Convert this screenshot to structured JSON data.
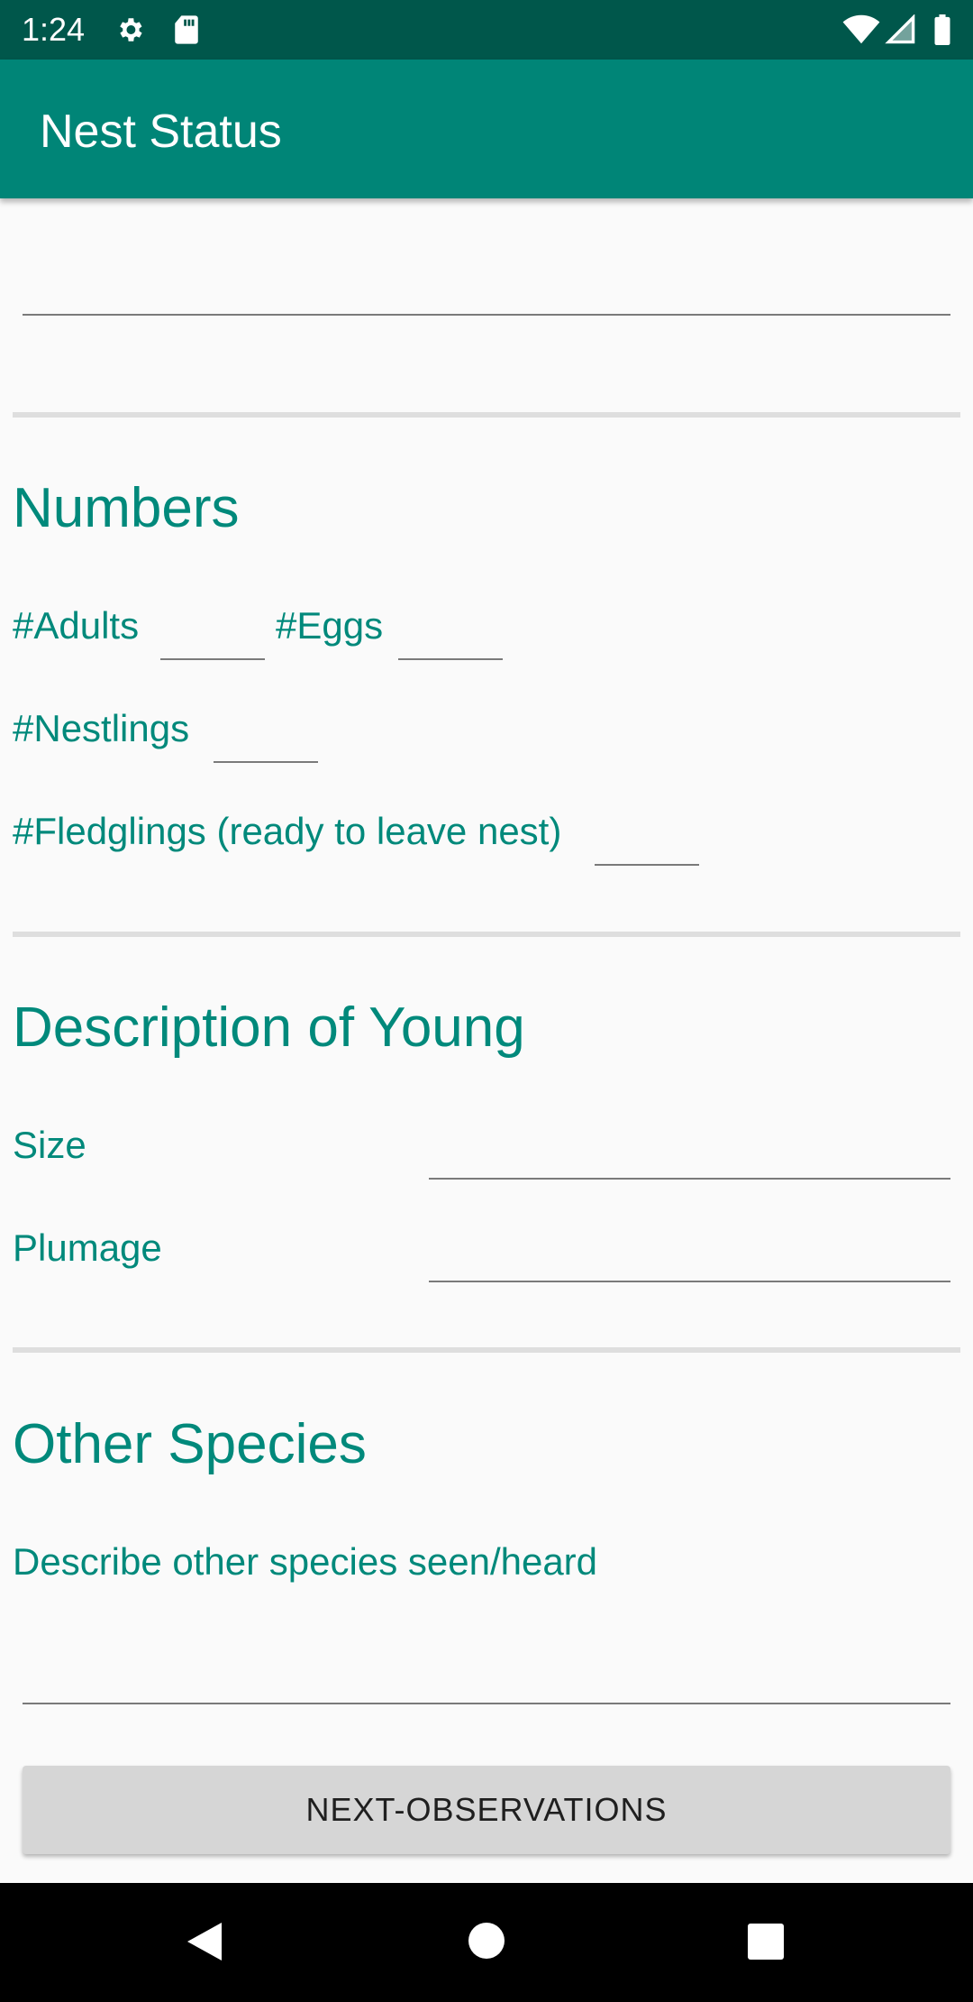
{
  "status_bar": {
    "time": "1:24",
    "icons": [
      "gear-icon",
      "sd-card-icon",
      "wifi-icon",
      "signal-icon",
      "battery-icon"
    ]
  },
  "app_bar": {
    "title": "Nest Status"
  },
  "numbers": {
    "heading": "Numbers",
    "adults_label": "#Adults",
    "eggs_label": "#Eggs",
    "nestlings_label": "#Nestlings",
    "fledglings_label": "#Fledglings (ready to leave nest)"
  },
  "young": {
    "heading": "Description of Young",
    "size_label": "Size",
    "plumage_label": "Plumage"
  },
  "other_species": {
    "heading": "Other Species",
    "describe_label": "Describe other species seen/heard"
  },
  "button": {
    "label": "NEXT-OBSERVATIONS"
  },
  "colors": {
    "status_bar": "#00574b",
    "app_bar": "#008577",
    "accent_text": "#00897b",
    "background": "#fafafa",
    "button": "#d6d6d6"
  }
}
